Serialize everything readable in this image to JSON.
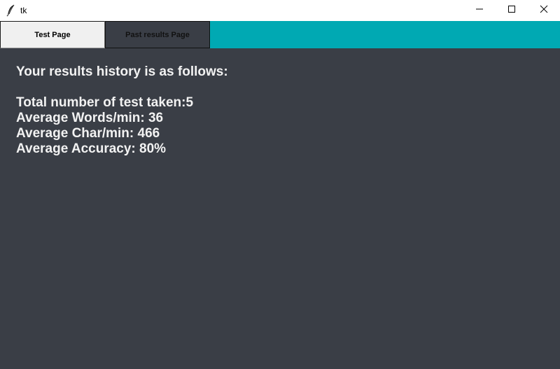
{
  "window": {
    "title": "tk",
    "app_icon": "feather-icon",
    "controls": [
      "minimize-icon",
      "maximize-icon",
      "close-icon"
    ]
  },
  "tabs": [
    {
      "label": "Test Page",
      "selected": true
    },
    {
      "label": "Past results Page",
      "selected": false
    }
  ],
  "colors": {
    "background": "#3a3e46",
    "tab_bar": "#00a9b3",
    "text": "#f2f2f2"
  },
  "results": {
    "heading": "Your results history is as follows:",
    "total_tests": "Total number of test taken:5",
    "avg_words": "Average Words/min: 36",
    "avg_chars": "Average Char/min: 466",
    "avg_accuracy": "Average Accuracy: 80%"
  }
}
